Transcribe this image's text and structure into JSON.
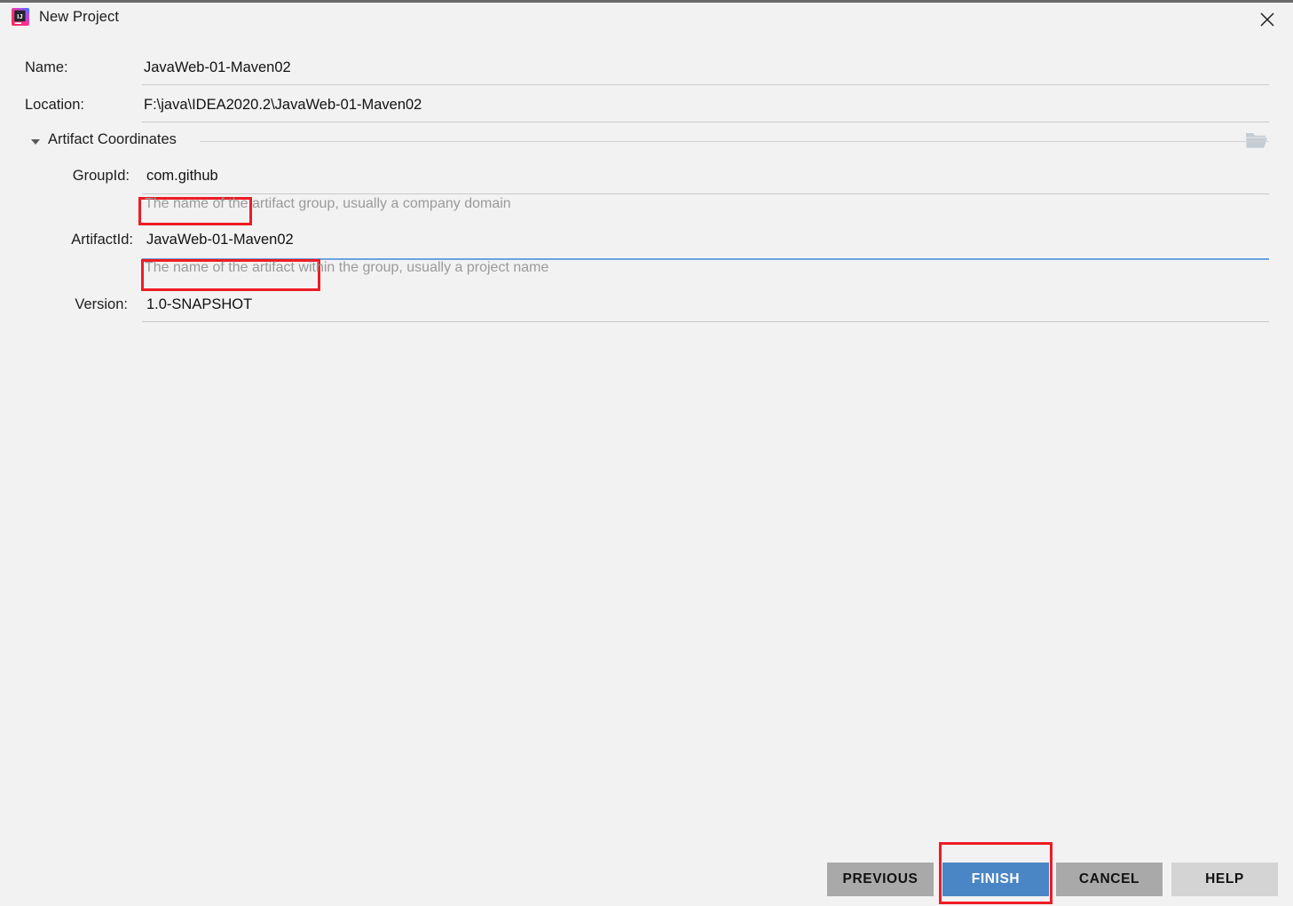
{
  "window": {
    "title": "New Project",
    "app_icon": "intellij-idea-icon",
    "close_icon": "close-icon",
    "background_color": "#f2f2f2"
  },
  "form": {
    "name": {
      "label": "Name:",
      "value": "JavaWeb-01-Maven02"
    },
    "location": {
      "label": "Location:",
      "value": "F:\\java\\IDEA2020.2\\JavaWeb-01-Maven02",
      "browse_icon": "folder-icon"
    },
    "artifact_coordinates": {
      "section_label": "Artifact Coordinates",
      "expanded": true,
      "collapse_icon": "chevron-down-icon",
      "group_id": {
        "label": "GroupId:",
        "value": "com.github",
        "hint": "The name of the artifact group, usually a company domain",
        "highlighted": true
      },
      "artifact_id": {
        "label": "ArtifactId:",
        "value": "JavaWeb-01-Maven02",
        "hint": "The name of the artifact within the group, usually a project name",
        "highlighted": true,
        "focused": true
      },
      "version": {
        "label": "Version:",
        "value": "1.0-SNAPSHOT"
      }
    }
  },
  "buttons": {
    "previous": "PREVIOUS",
    "finish": "FINISH",
    "cancel": "CANCEL",
    "help": "HELP"
  },
  "colors": {
    "accent_blue": "#4a86c5",
    "focus_underline": "#6aa3e0",
    "annotation_red": "#ee1b24",
    "button_gray": "#a9a9a9",
    "button_light_gray": "#d4d4d4",
    "hint_gray": "#9a9a9a"
  }
}
